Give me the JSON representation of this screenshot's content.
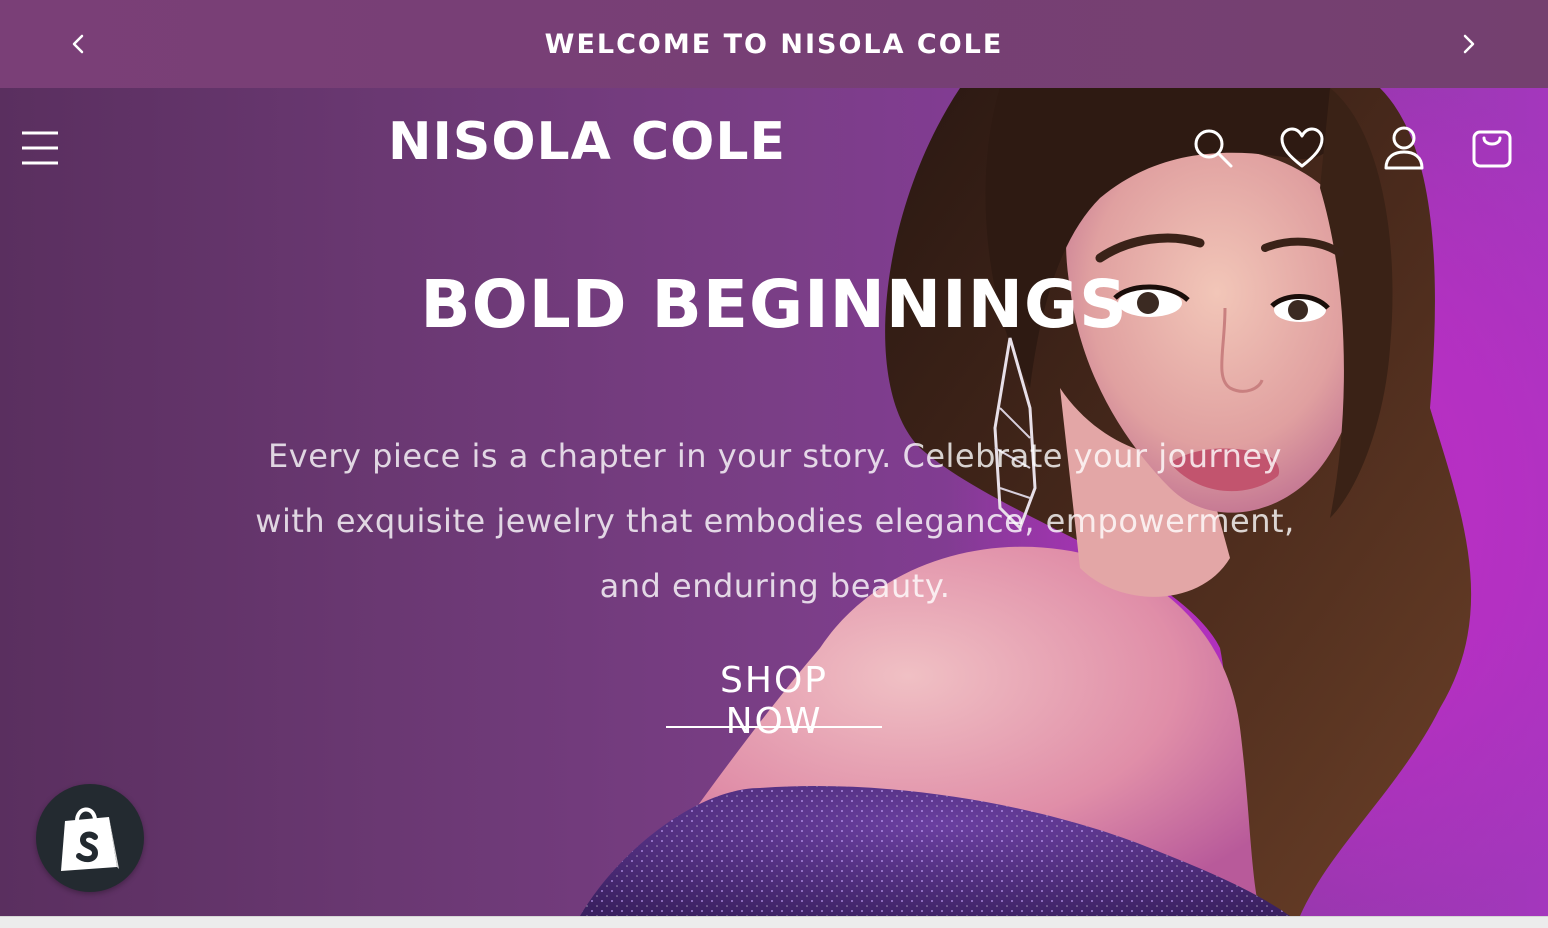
{
  "announcement": {
    "text": "WELCOME TO NISOLA COLE",
    "prev_icon": "chevron-left-icon",
    "next_icon": "chevron-right-icon"
  },
  "header": {
    "logo": "NISOLA COLE",
    "icons": [
      "menu-icon",
      "search-icon",
      "heart-icon",
      "account-icon",
      "cart-icon"
    ]
  },
  "hero": {
    "title": "BOLD BEGINNINGS",
    "subtitle": "Every piece is a chapter in your story. Celebrate your journey with exquisite jewelry that embodies elegance, empowerment, and enduring beauty.",
    "cta": "SHOP NOW"
  },
  "shopify_badge": {
    "icon": "shopify-bag-icon"
  },
  "colors": {
    "announcement_bg": "#783f76",
    "hero_purple": "#a437bd",
    "text": "#ffffff"
  }
}
